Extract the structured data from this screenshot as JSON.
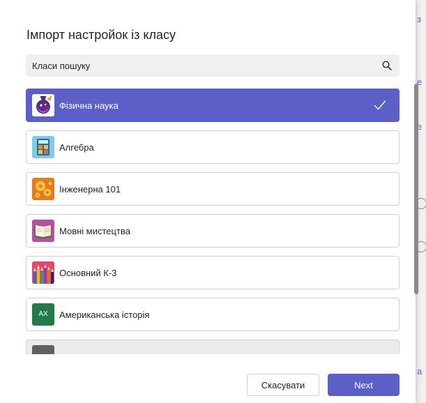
{
  "dialog": {
    "title": "Імпорт настройок із класу"
  },
  "search": {
    "placeholder": "Класи пошуку",
    "icon": "search-icon"
  },
  "classes": [
    {
      "label": "Фізична наука",
      "icon": "science-flask-icon",
      "selected": true
    },
    {
      "label": "Алгебра",
      "icon": "calculator-icon",
      "selected": false
    },
    {
      "label": "Інженерна 101",
      "icon": "gears-icon",
      "selected": false
    },
    {
      "label": "Мовні мистецтва",
      "icon": "open-book-icon",
      "selected": false
    },
    {
      "label": "Основний К-3",
      "icon": "colored-pencils-icon",
      "selected": false
    },
    {
      "label": "Американська історія",
      "icon": "initials-avatar",
      "initials": "AX",
      "selected": false
    },
    {
      "label": "",
      "icon": "placeholder-thumb",
      "selected": false
    }
  ],
  "buttons": {
    "cancel_label": "Скасувати",
    "next_label": "Next"
  },
  "colors": {
    "accent": "#5b5fc7",
    "item_border": "#d1d1d1",
    "search_bg": "#f0f0f0",
    "history_green": "#237b4b"
  }
}
